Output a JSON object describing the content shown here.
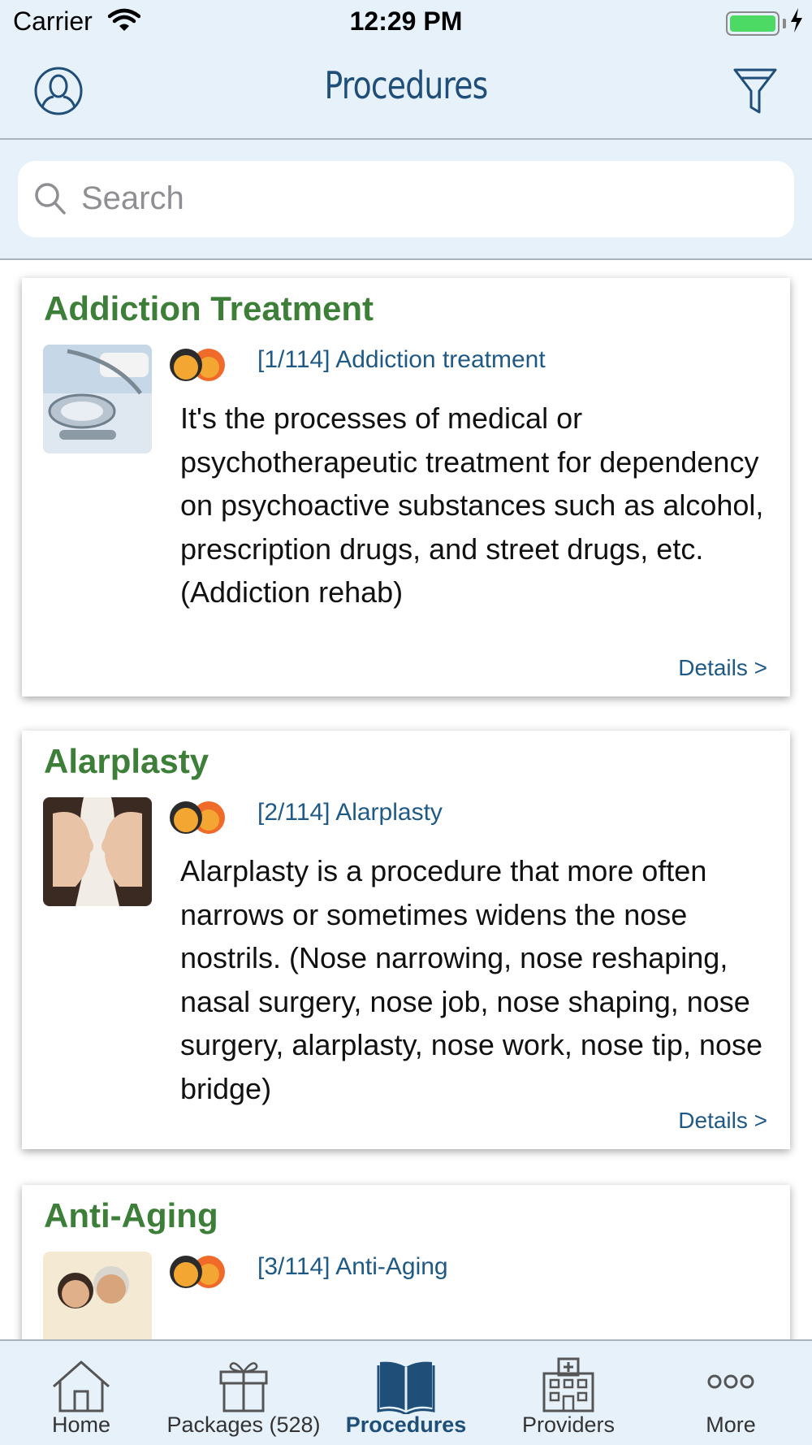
{
  "status_bar": {
    "carrier": "Carrier",
    "time": "12:29 PM"
  },
  "header": {
    "title": "Procedures"
  },
  "search": {
    "placeholder": "Search",
    "value": ""
  },
  "colors": {
    "accent": "#1f4e79",
    "title_green": "#3d7f39",
    "link_blue": "#1f5a87",
    "header_bg": "#e6f1fa"
  },
  "procedures": [
    {
      "title": "Addiction Treatment",
      "tag": "[1/114] Addiction treatment",
      "description": "It's the processes of medical or psychotherapeutic treatment for dependency on psychoactive substances such as alcohol, prescription drugs, and street drugs, etc. (Addiction rehab)",
      "details": "Details >",
      "thumb_icon": "stethoscope-image"
    },
    {
      "title": "Alarplasty",
      "tag": "[2/114] Alarplasty",
      "description": "Alarplasty is a procedure that more often narrows or sometimes widens the nose nostrils. (Nose narrowing, nose reshaping, nasal surgery, nose job, nose shaping, nose surgery, alarplasty, nose work, nose tip, nose bridge)",
      "details": "Details >",
      "thumb_icon": "faces-profile-image"
    },
    {
      "title": "Anti-Aging",
      "tag": "[3/114] Anti-Aging",
      "thumb_icon": "elderly-couple-image"
    }
  ],
  "tabs": [
    {
      "label": "Home",
      "icon": "home-icon"
    },
    {
      "label": "Packages (528)",
      "icon": "gift-icon"
    },
    {
      "label": "Procedures",
      "icon": "book-icon",
      "active": true
    },
    {
      "label": "Providers",
      "icon": "hospital-icon"
    },
    {
      "label": "More",
      "icon": "more-icon"
    }
  ]
}
